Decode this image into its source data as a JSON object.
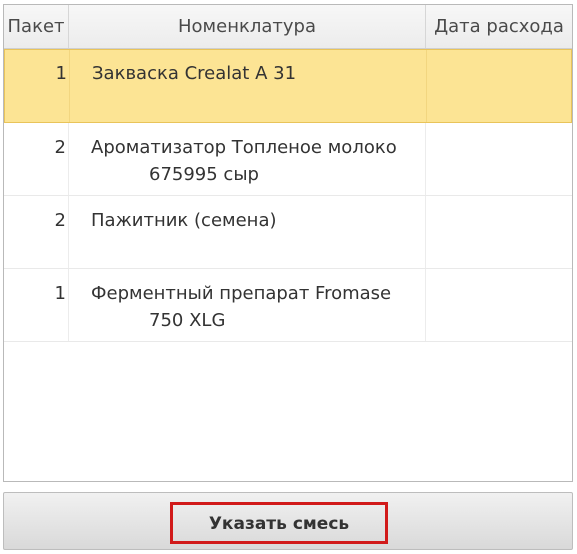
{
  "table": {
    "columns": [
      "Пакет",
      "Номенклатура",
      "Дата расхода"
    ],
    "rows": [
      {
        "qty": "1",
        "name_line1": "Закваска Crealat A 31",
        "name_line2": "",
        "date": "",
        "selected": true
      },
      {
        "qty": "2",
        "name_line1": "Ароматизатор Топленое молоко",
        "name_line2": "675995 сыр",
        "date": "",
        "selected": false
      },
      {
        "qty": "2",
        "name_line1": "Пажитник (семена)",
        "name_line2": "",
        "date": "",
        "selected": false
      },
      {
        "qty": "1",
        "name_line1": "Ферментный препарат Fromase",
        "name_line2": "750 XLG",
        "date": "",
        "selected": false
      }
    ]
  },
  "actions": {
    "specify_mix_label": "Указать смесь"
  },
  "colors": {
    "selected_row": "#fce494",
    "highlight_border": "#d11a1a"
  }
}
